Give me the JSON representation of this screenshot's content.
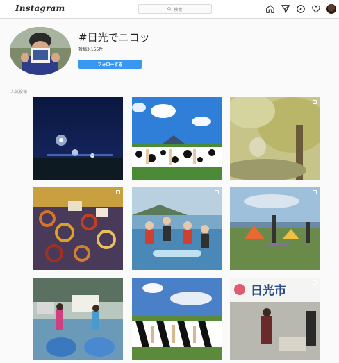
{
  "nav": {
    "logo": "Instagram",
    "search_placeholder": "検索",
    "icons": [
      "home-icon",
      "direct-icon",
      "explore-icon",
      "activity-heart-icon",
      "profile-avatar"
    ]
  },
  "header": {
    "hashtag": "#日光でニコッ",
    "post_count": "投稿3,155件",
    "follow_label": "フォローする"
  },
  "section": {
    "label": "人気投稿"
  },
  "posts": [
    {
      "name": "post-night-city",
      "multi": false
    },
    {
      "name": "post-cows-yoga-mountain",
      "multi": false
    },
    {
      "name": "post-autumn-ginkgo",
      "multi": true
    },
    {
      "name": "post-rope-bracelets",
      "multi": true
    },
    {
      "name": "post-sup-yoga-group",
      "multi": true
    },
    {
      "name": "post-lakeside-yoga",
      "multi": true
    },
    {
      "name": "post-sup-boards-kids",
      "multi": false
    },
    {
      "name": "post-cows-yoga-line",
      "multi": false
    },
    {
      "name": "post-nikko-city-tent",
      "multi": true
    }
  ],
  "banner": {
    "nikko_city_text": "日光市"
  },
  "colors": {
    "accent": "#3897f0",
    "border": "#dbdbdb",
    "background": "#fafafa"
  }
}
